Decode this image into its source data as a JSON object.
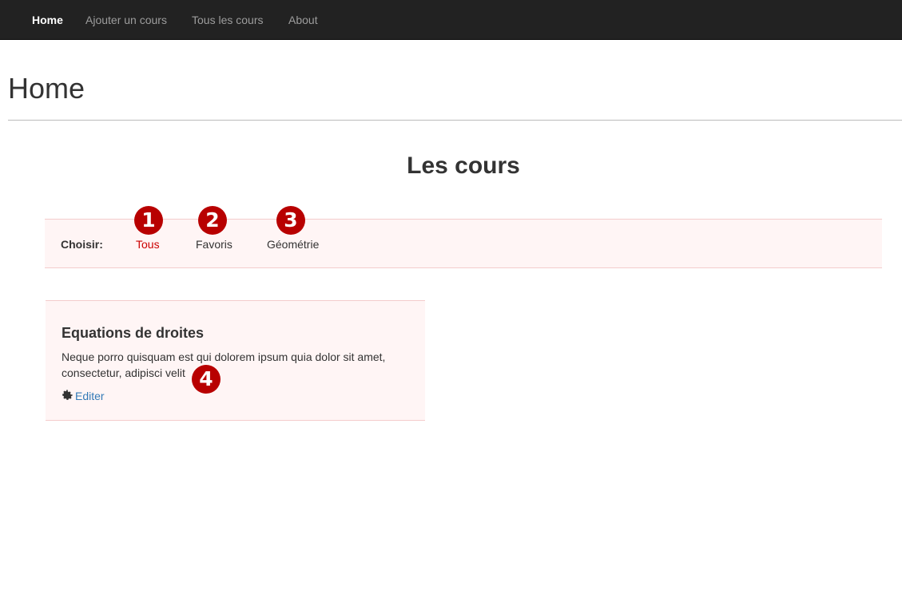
{
  "navbar": {
    "items": [
      {
        "label": "Home",
        "active": true
      },
      {
        "label": "Ajouter un cours"
      },
      {
        "label": "Tous les cours"
      },
      {
        "label": "About"
      }
    ],
    "background": "#222222"
  },
  "page": {
    "title": "Home"
  },
  "section": {
    "title": "Les cours"
  },
  "filters": {
    "label": "Choisir:",
    "items": [
      {
        "label": "Tous",
        "active": true
      },
      {
        "label": "Favoris"
      },
      {
        "label": "Géométrie"
      }
    ],
    "active_color": "#cc0000",
    "background": "#fff5f5"
  },
  "courses": [
    {
      "title": "Equations de droites",
      "description": "Neque porro quisquam est qui dolorem ipsum quia dolor sit amet, consectetur, adipisci velit",
      "edit_label": "Editer",
      "edit_icon": "gear-icon"
    }
  ],
  "annotations": {
    "markers": [
      "1",
      "2",
      "3",
      "4"
    ],
    "color": "#b80000"
  }
}
